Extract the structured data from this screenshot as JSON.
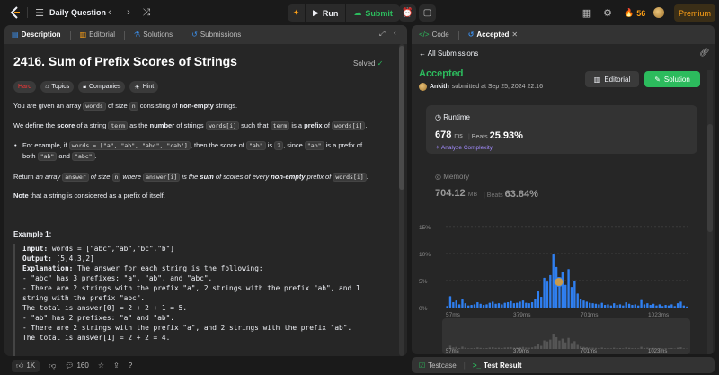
{
  "topbar": {
    "daily_label": "Daily Question",
    "run_label": "Run",
    "submit_label": "Submit",
    "streak_count": "56",
    "premium_label": "Premium"
  },
  "left_tabs": [
    "Description",
    "Editorial",
    "Solutions",
    "Submissions"
  ],
  "problem": {
    "title": "2416. Sum of Prefix Scores of Strings",
    "solved_label": "Solved",
    "difficulty": "Hard",
    "chips": [
      "Topics",
      "Companies",
      "Hint"
    ],
    "p1_a": "You are given an array ",
    "p1_code": "words",
    "p1_b": " of size ",
    "p1_code2": "n",
    "p1_c": " consisting of ",
    "p1_bold": "non-empty",
    "p1_d": " strings.",
    "p2_a": "We define the ",
    "p2_bold1": "score",
    "p2_b": " of a string ",
    "p2_code1": "term",
    "p2_c": " as the ",
    "p2_bold2": "number",
    "p2_d": " of strings ",
    "p2_code2": "words[i]",
    "p2_e": " such that ",
    "p2_code3": "term",
    "p2_f": " is a ",
    "p2_bold3": "prefix",
    "p2_g": " of ",
    "p2_code4": "words[i]",
    "p2_h": ".",
    "bullet_a": "For example, if ",
    "bullet_code1": "words = [\"a\", \"ab\", \"abc\", \"cab\"]",
    "bullet_b": ", then the score of ",
    "bullet_code2": "\"ab\"",
    "bullet_c": " is ",
    "bullet_code3": "2",
    "bullet_d": ", since ",
    "bullet_code4": "\"ab\"",
    "bullet_e": " is a prefix of",
    "bullet_f": "both ",
    "bullet_code5": "\"ab\"",
    "bullet_g": " and ",
    "bullet_code6": "\"abc\"",
    "bullet_h": ".",
    "p3_a": "Return ",
    "p3_b": "an array ",
    "p3_code1": "answer",
    "p3_c": " of size ",
    "p3_code2": "n",
    "p3_d": " where ",
    "p3_code3": "answer[i]",
    "p3_e": " is the ",
    "p3_bold1": "sum",
    "p3_f": " of scores of every ",
    "p3_bold2": "non-empty",
    "p3_g": " prefix of ",
    "p3_code4": "words[i]",
    "p3_h": ".",
    "note_bold": "Note",
    "note_rest": " that a string is considered as a prefix of itself.",
    "example_title": "Example 1:",
    "example_lines": [
      {
        "label": "Input:",
        "text": " words = [\"abc\",\"ab\",\"bc\",\"b\"]"
      },
      {
        "label": "Output:",
        "text": " [5,4,3,2]"
      },
      {
        "label": "Explanation:",
        "text": " The answer for each string is the following:"
      },
      {
        "label": "",
        "text": "- \"abc\" has 3 prefixes: \"a\", \"ab\", and \"abc\"."
      },
      {
        "label": "",
        "text": "- There are 2 strings with the prefix \"a\", 2 strings with the prefix \"ab\", and 1"
      },
      {
        "label": "",
        "text": "string with the prefix \"abc\"."
      },
      {
        "label": "",
        "text": "The total is answer[0] = 2 + 2 + 1 = 5."
      },
      {
        "label": "",
        "text": "- \"ab\" has 2 prefixes: \"a\" and \"ab\"."
      },
      {
        "label": "",
        "text": "- There are 2 strings with the prefix \"a\", and 2 strings with the prefix \"ab\"."
      },
      {
        "label": "",
        "text": "The total is answer[1] = 2 + 2 = 4."
      }
    ]
  },
  "footer": {
    "likes": "1K",
    "comments": "160"
  },
  "right_tabs": [
    "Code",
    "Accepted"
  ],
  "submission": {
    "all_label": "All Submissions",
    "status": "Accepted",
    "user": "Ankith",
    "submitted_text": " submitted at Sep 25, 2024 22:16",
    "editorial_label": "Editorial",
    "solution_label": "Solution",
    "runtime_label": "Runtime",
    "runtime_value": "678",
    "runtime_unit": "ms",
    "runtime_beats_label": "Beats",
    "runtime_beats": "25.93%",
    "analyze_label": "Analyze Complexity",
    "memory_label": "Memory",
    "memory_value": "704.12",
    "memory_unit": "MB",
    "memory_beats_label": "Beats",
    "memory_beats": "63.84%"
  },
  "chart_data": {
    "type": "bar",
    "y_ticks": [
      "15%",
      "10%",
      "5%",
      "0%"
    ],
    "ylim": [
      0,
      15
    ],
    "x_ticks": [
      "57ms",
      "379ms",
      "701ms",
      "1023ms"
    ],
    "mini_x_ticks": [
      "57ms",
      "379ms",
      "701ms",
      "1023ms"
    ],
    "accent": "#2f7ff0",
    "values": [
      0.3,
      2.1,
      1.0,
      1.3,
      0.6,
      1.5,
      0.8,
      0.4,
      0.5,
      0.6,
      1.0,
      0.7,
      0.5,
      0.6,
      0.9,
      1.1,
      0.7,
      0.8,
      0.6,
      0.9,
      1.0,
      1.2,
      0.8,
      0.9,
      1.1,
      1.3,
      0.9,
      0.8,
      1.0,
      1.6,
      3.0,
      2.0,
      5.5,
      4.8,
      6.0,
      9.8,
      7.5,
      5.4,
      6.6,
      4.2,
      7.1,
      3.8,
      5.0,
      2.6,
      1.6,
      1.3,
      1.1,
      0.9,
      0.8,
      0.7,
      0.6,
      0.9,
      0.5,
      0.6,
      0.4,
      0.8,
      0.5,
      0.6,
      0.4,
      1.0,
      0.7,
      0.5,
      0.6,
      0.4,
      1.4,
      0.6,
      0.8,
      0.5,
      0.7,
      0.4,
      0.6,
      0.3,
      0.5,
      0.4,
      0.6,
      0.3,
      0.8,
      1.1,
      0.4,
      0.2
    ]
  },
  "bottom": {
    "testcase_label": "Testcase",
    "result_label": "Test Result"
  }
}
